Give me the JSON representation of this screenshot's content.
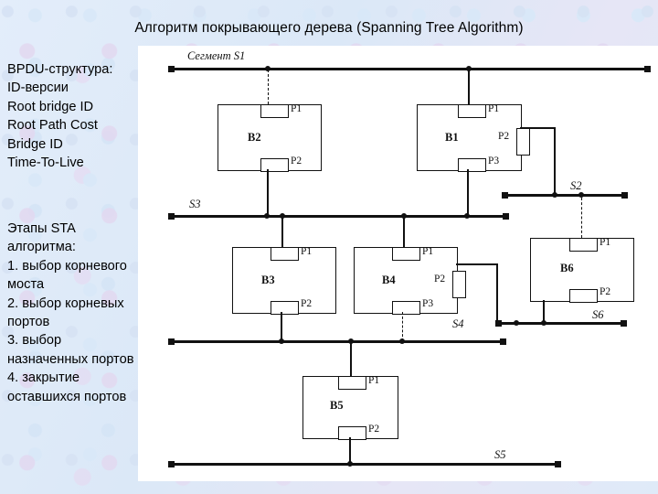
{
  "slide": {
    "title": "Алгоритм покрывающего дерева (Spanning Tree Algorithm)",
    "background_color": "#dde9f8",
    "panel_color": "#ffffff",
    "line_color": "#111111"
  },
  "left_panel": {
    "bpdu": {
      "heading": "BPDU-структура:",
      "lines": [
        "ID-версии",
        "Root bridge ID",
        "Root Path Cost",
        "Bridge ID",
        "Time-To-Live"
      ],
      "text": "BPDU-структура:\nID-версии\nRoot bridge ID\nRoot Path Cost\nBridge ID\nTime-To-Live"
    },
    "stages": {
      "heading": "Этапы STA алгоритма:",
      "items": [
        "1. выбор корневого моста",
        "2. выбор корневых портов",
        "3. выбор назначенных портов",
        "4. закрытие оставшихся портов"
      ],
      "text": "Этапы STA алгоритма:\n1. выбор корневого моста\n2. выбор корневых портов\n3. выбор назначенных портов\n4. закрытие оставшихся портов"
    }
  },
  "diagram": {
    "segments": [
      {
        "id": "S1",
        "label": "Сегмент S1"
      },
      {
        "id": "S2",
        "label": "S2"
      },
      {
        "id": "S3",
        "label": "S3"
      },
      {
        "id": "S4",
        "label": "S4"
      },
      {
        "id": "S5",
        "label": "S5"
      },
      {
        "id": "S6",
        "label": "S6"
      }
    ],
    "bridges": [
      {
        "id": "B2",
        "label": "B2",
        "ports": [
          {
            "id": "P1",
            "label": "P1"
          },
          {
            "id": "P2",
            "label": "P2"
          }
        ]
      },
      {
        "id": "B1",
        "label": "B1",
        "ports": [
          {
            "id": "P1",
            "label": "P1"
          },
          {
            "id": "P2",
            "label": "P2"
          },
          {
            "id": "P3",
            "label": "P3"
          }
        ]
      },
      {
        "id": "B3",
        "label": "B3",
        "ports": [
          {
            "id": "P1",
            "label": "P1"
          },
          {
            "id": "P2",
            "label": "P2"
          }
        ]
      },
      {
        "id": "B4",
        "label": "B4",
        "ports": [
          {
            "id": "P1",
            "label": "P1"
          },
          {
            "id": "P2",
            "label": "P2"
          },
          {
            "id": "P3",
            "label": "P3"
          }
        ]
      },
      {
        "id": "B6",
        "label": "B6",
        "ports": [
          {
            "id": "P1",
            "label": "P1"
          },
          {
            "id": "P2",
            "label": "P2"
          }
        ]
      },
      {
        "id": "B5",
        "label": "B5",
        "ports": [
          {
            "id": "P1",
            "label": "P1"
          },
          {
            "id": "P2",
            "label": "P2"
          }
        ]
      }
    ]
  }
}
